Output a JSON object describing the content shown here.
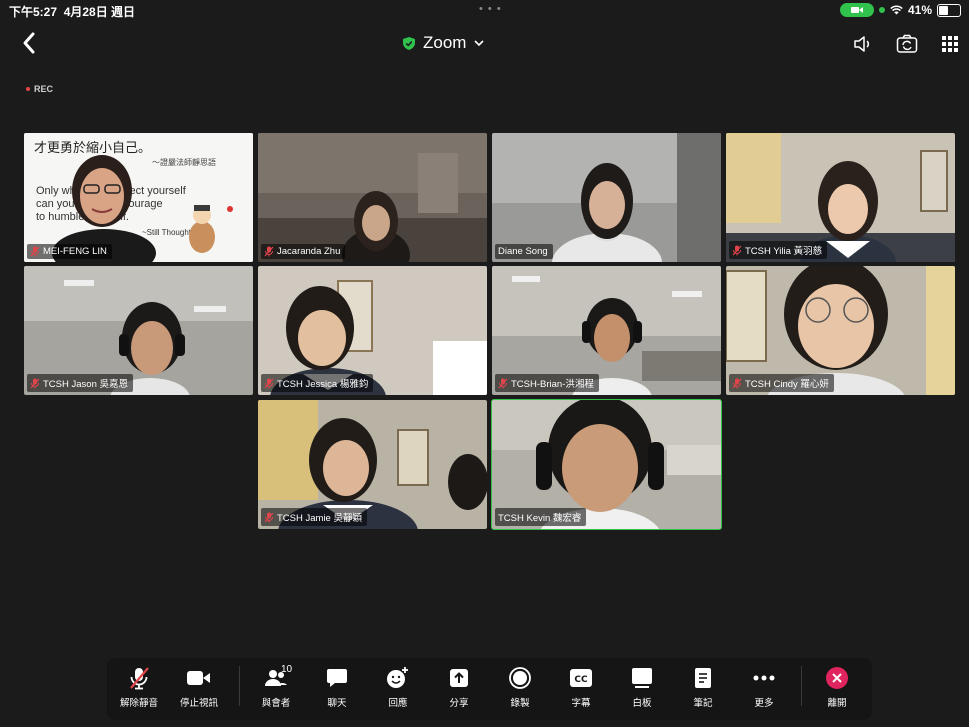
{
  "status": {
    "time": "下午5:27",
    "date": "4月28日 週日",
    "battery": "41%",
    "dots": "• • •"
  },
  "header": {
    "title": "Zoom",
    "back_icon": "chevron-left-icon",
    "shield_color": "#31c24d"
  },
  "recording": {
    "label": "REC"
  },
  "participants": [
    {
      "name": "MEI-FENG LIN",
      "muted": true,
      "quote_zh_1": "才更勇於縮小自己。",
      "quote_zh_2": "～證嚴法師靜思語",
      "quote_en_1": "Only when we respect yourself",
      "quote_en_2": "can you have the courage",
      "quote_en_3": "to humble yourself.",
      "quote_src": "~Still Thoughts"
    },
    {
      "name": "Jacaranda Zhu",
      "muted": true
    },
    {
      "name": "Diane Song",
      "muted": false
    },
    {
      "name": "TCSH Yilia 黃羽慈",
      "muted": true
    },
    {
      "name": "TCSH Jason 吳嘉恩",
      "muted": true
    },
    {
      "name": "TCSH Jessica 楊雅鈞",
      "muted": true
    },
    {
      "name": "TCSH-Brian-洪湘程",
      "muted": true
    },
    {
      "name": "TCSH Cindy 羅心妍",
      "muted": true
    },
    {
      "name": "TCSH Jamie 吳靜穎",
      "muted": true
    },
    {
      "name": "TCSH Kevin 魏宏睿",
      "muted": false,
      "active_speaker": true
    }
  ],
  "toolbar": {
    "unmute": "解除靜音",
    "stop_video": "停止視訊",
    "participants": "與會者",
    "participants_count": "10",
    "chat": "聊天",
    "react": "回應",
    "share": "分享",
    "record": "錄製",
    "captions": "字幕",
    "captions_icon_text": "CC",
    "whiteboard": "白板",
    "notes": "筆記",
    "more": "更多",
    "leave": "離開"
  },
  "colors": {
    "leave": "#e0245e",
    "active": "#35c24a",
    "muted_icon": "#e0454b"
  }
}
